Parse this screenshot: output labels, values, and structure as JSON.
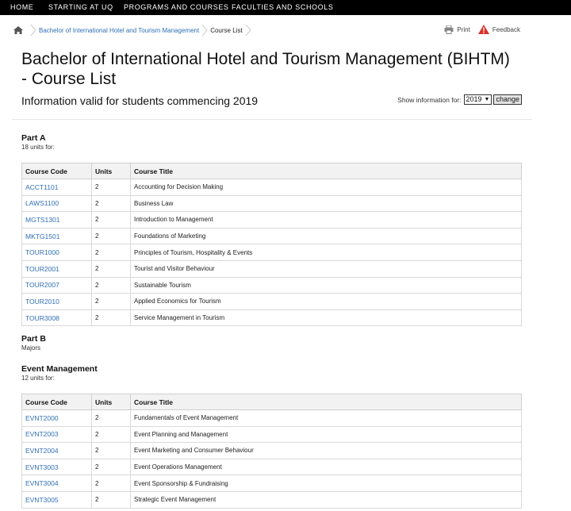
{
  "topnav": [
    "HOME",
    "STARTING AT UQ",
    "PROGRAMS AND COURSES",
    "FACULTIES AND SCHOOLS"
  ],
  "breadcrumb": {
    "link": "Bachelor of International Hotel and Tourism Management",
    "current": "Course List"
  },
  "tools": {
    "print": "Print",
    "feedback": "Feedback"
  },
  "page": {
    "title": "Bachelor of International Hotel and Tourism Management (BIHTM) - Course List",
    "subtitle": "Information valid for students commencing 2019",
    "show_label": "Show information for:",
    "year": "2019",
    "change": "change"
  },
  "columns": [
    "Course Code",
    "Units",
    "Course Title"
  ],
  "part_a": {
    "heading": "Part A",
    "note": "18 units for:",
    "rows": [
      [
        "ACCT1101",
        "2",
        "Accounting for Decision Making"
      ],
      [
        "LAWS1100",
        "2",
        "Business Law"
      ],
      [
        "MGTS1301",
        "2",
        "Introduction to Management"
      ],
      [
        "MKTG1501",
        "2",
        "Foundations of Marketing"
      ],
      [
        "TOUR1000",
        "2",
        "Principles of Tourism, Hospitality & Events"
      ],
      [
        "TOUR2001",
        "2",
        "Tourist and Visitor Behaviour"
      ],
      [
        "TOUR2007",
        "2",
        "Sustainable Tourism"
      ],
      [
        "TOUR2010",
        "2",
        "Applied Economics for Tourism"
      ],
      [
        "TOUR3008",
        "2",
        "Service Management in Tourism"
      ]
    ]
  },
  "part_b": {
    "heading": "Part B",
    "note": "Majors"
  },
  "event": {
    "heading": "Event Management",
    "note": "12 units for:",
    "rows": [
      [
        "EVNT2000",
        "2",
        "Fundamentals of Event Management"
      ],
      [
        "EVNT2003",
        "2",
        "Event Planning and Management"
      ],
      [
        "EVNT2004",
        "2",
        "Event Marketing and Consumer Behaviour"
      ],
      [
        "EVNT3003",
        "2",
        "Event Operations Management"
      ],
      [
        "EVNT3004",
        "2",
        "Event Sponsorship & Fundraising"
      ],
      [
        "EVNT3005",
        "2",
        "Strategic Event Management"
      ]
    ]
  },
  "colors": {
    "link": "#2f6fb7",
    "nav_bg": "#000000",
    "warning": "#d9342b"
  }
}
